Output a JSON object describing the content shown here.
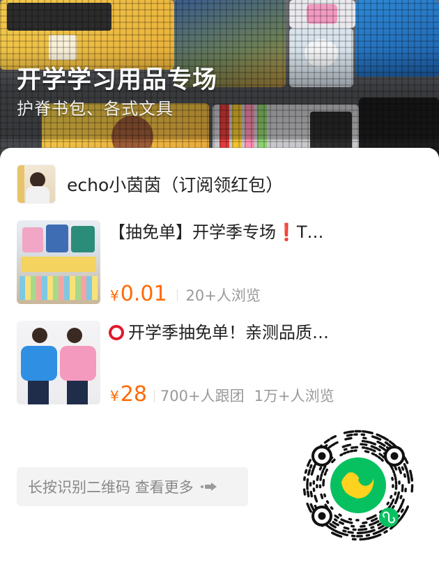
{
  "hero": {
    "title": "开学学习用品专场",
    "subtitle": "护脊书包、各式文具"
  },
  "shop": {
    "name": "echo小茵茵（订阅领红包）"
  },
  "products": [
    {
      "title_prefix": "【抽免单】开学季专场",
      "title_mark": "❗",
      "title_suffix": "T…",
      "currency": "¥",
      "price": "0.01",
      "meta": [
        "20+人浏览"
      ]
    },
    {
      "title_text": "开学季抽免单！亲测品质…",
      "currency": "¥",
      "price": "28",
      "meta": [
        "700+人跟团",
        "1万+人浏览"
      ]
    }
  ],
  "more_button": {
    "label": "长按识别二维码 查看更多"
  },
  "colors": {
    "accent_price": "#ff6a00",
    "mini_program_green": "#07c160",
    "logo_yellow": "#ffd21f",
    "alert_red": "#e0192b"
  },
  "icons": [
    "arrow-right-icon",
    "qr-code-icon",
    "mini-program-icon",
    "circle-mark-icon",
    "exclamation-icon"
  ]
}
